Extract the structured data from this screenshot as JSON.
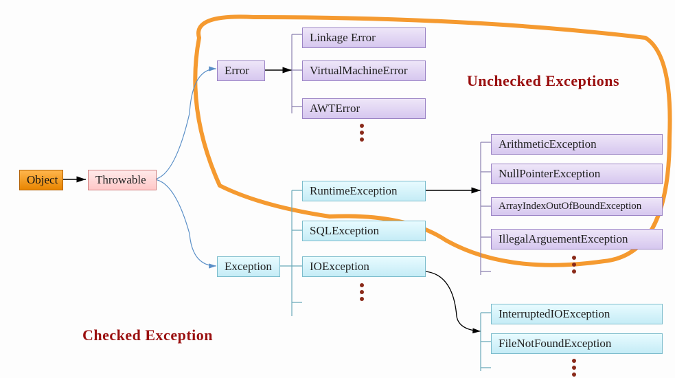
{
  "labels": {
    "unchecked": "Unchecked Exceptions",
    "checked": "Checked Exception"
  },
  "nodes": {
    "object": "Object",
    "throwable": "Throwable",
    "error": "Error",
    "exception": "Exception",
    "linkageError": "Linkage Error",
    "vmError": "VirtualMachineError",
    "awtError": "AWTError",
    "runtimeEx": "RuntimeException",
    "sqlEx": "SQLException",
    "ioEx": "IOException",
    "arithEx": "ArithmeticException",
    "npEx": "NullPointerException",
    "aioobEx": "ArrayIndexOutOfBoundException",
    "illegalArgEx": "IllegalArguementException",
    "intIoEx": "InterruptedIOException",
    "fnfEx": "FileNotFoundException"
  }
}
